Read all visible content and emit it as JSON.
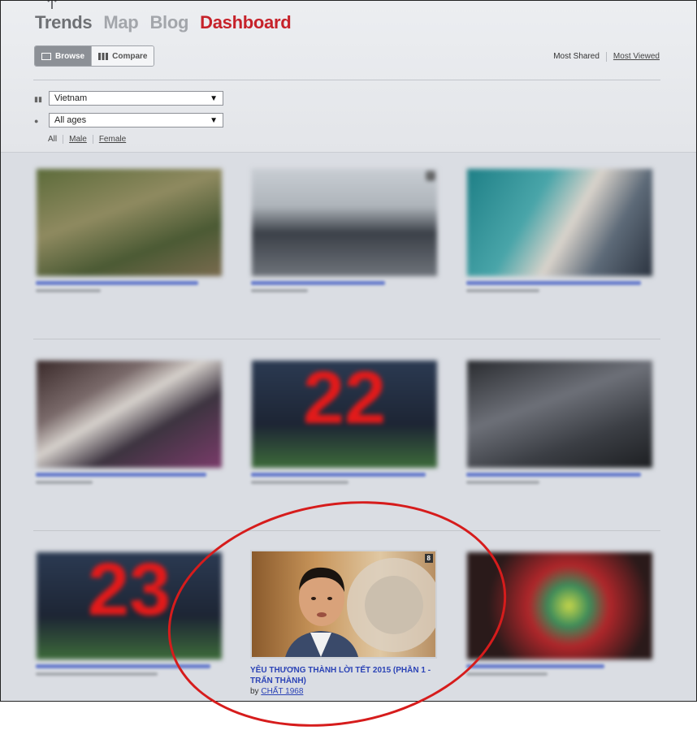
{
  "nav": {
    "items": [
      "Trends",
      "Map",
      "Blog",
      "Dashboard"
    ],
    "active": "Dashboard"
  },
  "view_toggle": {
    "browse": "Browse",
    "compare": "Compare",
    "selected": "Browse"
  },
  "sort": {
    "most_shared": "Most Shared",
    "most_viewed": "Most Viewed"
  },
  "filters": {
    "country": "Vietnam",
    "age": "All ages",
    "gender": {
      "all": "All",
      "male": "Male",
      "female": "Female"
    }
  },
  "videos": [
    {
      "rank": "",
      "title": "",
      "channel": ""
    },
    {
      "rank": "2",
      "title": "",
      "channel": ""
    },
    {
      "rank": "",
      "title": "",
      "channel": ""
    },
    {
      "rank": "",
      "title": "",
      "channel": ""
    },
    {
      "rank": "",
      "title": "",
      "channel": "",
      "overlay": "22"
    },
    {
      "rank": "",
      "title": "",
      "channel": ""
    },
    {
      "rank": "",
      "title": "",
      "channel": "",
      "overlay": "23"
    },
    {
      "rank": "8",
      "title": "YÊU THƯƠNG THÀNH LỜI TẾT 2015 (PHẦN 1 - TRẤN THÀNH)",
      "channel": "CHẤT 1968",
      "by": "by"
    },
    {
      "rank": "",
      "title": "",
      "channel": ""
    }
  ],
  "colors": {
    "accent": "#c6222a",
    "link": "#2b43b6",
    "annotation": "#d61c1c"
  }
}
